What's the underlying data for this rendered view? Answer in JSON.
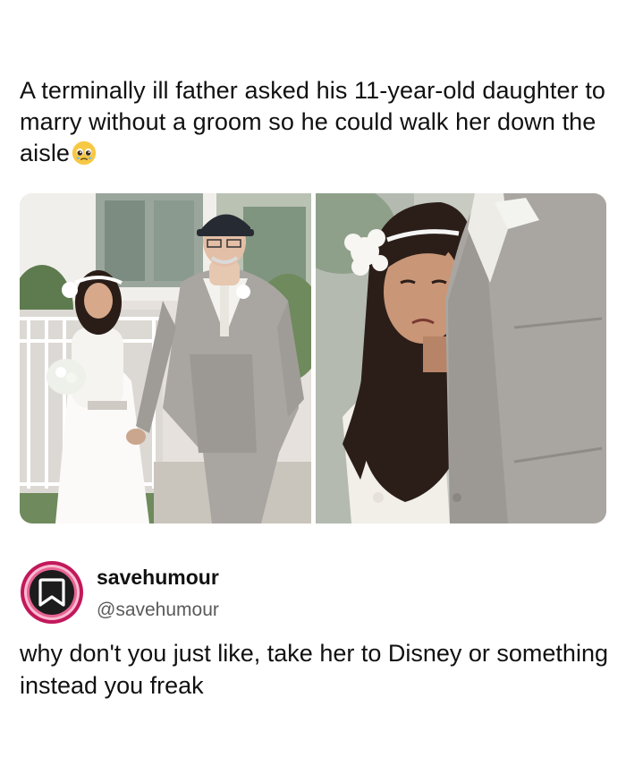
{
  "post": {
    "title": "A terminally ill father asked his 11-year-old daughter to marry without a groom so he could walk her down the aisle",
    "title_emoji": "pleading-face-with-tears-icon"
  },
  "photos": [
    {
      "name": "father-and-daughter-walking-photo"
    },
    {
      "name": "daughter-crying-closeup-photo"
    }
  ],
  "tweet": {
    "display_name": "savehumour",
    "handle": "@savehumour",
    "avatar_icon": "bookmark-icon",
    "text": "why don't you just like, take her to Disney or something instead you freak"
  },
  "colors": {
    "avatar_ring": "#c2185b",
    "avatar_fill": "#1c1c1c",
    "suit": "#a9a6a2"
  }
}
